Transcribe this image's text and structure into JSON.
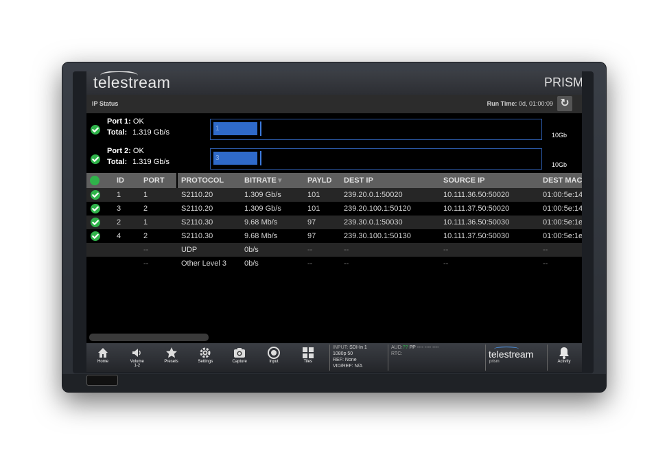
{
  "brand": {
    "logo": "telestream",
    "product": "PRISM"
  },
  "status": {
    "title": "IP Status",
    "runtime_label": "Run Time:",
    "runtime_value": "0d, 01:00:09",
    "reset_icon": "refresh-icon"
  },
  "ports": [
    {
      "label": "Port 1:",
      "status": "OK",
      "total_label": "Total:",
      "total": "1.319 Gb/s",
      "bar_label": "1",
      "bar_fraction": 0.135,
      "scale": "10Gb"
    },
    {
      "label": "Port 2:",
      "status": "OK",
      "total_label": "Total:",
      "total": "1.319 Gb/s",
      "bar_label": "3",
      "bar_fraction": 0.135,
      "scale": "10Gb"
    }
  ],
  "table": {
    "headers": {
      "id": "ID",
      "port": "PORT",
      "protocol": "PROTOCOL",
      "bitrate": "BITRATE",
      "payld": "PAYLD",
      "dest_ip": "DEST IP",
      "source_ip": "SOURCE IP",
      "dest_mac": "DEST MAC"
    },
    "rows": [
      {
        "ok": true,
        "id": "1",
        "port": "1",
        "protocol": "S2110.20",
        "bitrate": "1.309 Gb/s",
        "payld": "101",
        "dest_ip": "239.20.0.1:50020",
        "source_ip": "10.111.36.50:50020",
        "dest_mac": "01:00:5e:14"
      },
      {
        "ok": true,
        "id": "3",
        "port": "2",
        "protocol": "S2110.20",
        "bitrate": "1.309 Gb/s",
        "payld": "101",
        "dest_ip": "239.20.100.1:50120",
        "source_ip": "10.111.37.50:50020",
        "dest_mac": "01:00:5e:14"
      },
      {
        "ok": true,
        "id": "2",
        "port": "1",
        "protocol": "S2110.30",
        "bitrate": "9.68 Mb/s",
        "payld": "97",
        "dest_ip": "239.30.0.1:50030",
        "source_ip": "10.111.36.50:50030",
        "dest_mac": "01:00:5e:1e"
      },
      {
        "ok": true,
        "id": "4",
        "port": "2",
        "protocol": "S2110.30",
        "bitrate": "9.68 Mb/s",
        "payld": "97",
        "dest_ip": "239.30.100.1:50130",
        "source_ip": "10.111.37.50:50030",
        "dest_mac": "01:00:5e:1e"
      },
      {
        "ok": false,
        "id": "",
        "port": "--",
        "protocol": "UDP",
        "bitrate": "0b/s",
        "payld": "--",
        "dest_ip": "--",
        "source_ip": "--",
        "dest_mac": "--"
      },
      {
        "ok": false,
        "id": "",
        "port": "--",
        "protocol": "Other Level 3",
        "bitrate": "0b/s",
        "payld": "--",
        "dest_ip": "--",
        "source_ip": "--",
        "dest_mac": "--"
      }
    ]
  },
  "nav": [
    {
      "label": "Home",
      "sub": "",
      "icon": "home-icon"
    },
    {
      "label": "Volume",
      "sub": "1-2",
      "icon": "speaker-icon"
    },
    {
      "label": "Presets",
      "sub": "",
      "icon": "star-icon"
    },
    {
      "label": "Settings",
      "sub": "",
      "icon": "gear-icon"
    },
    {
      "label": "Capture",
      "sub": "",
      "icon": "camera-icon"
    },
    {
      "label": "Input",
      "sub": "",
      "icon": "input-icon"
    },
    {
      "label": "Tiles",
      "sub": "",
      "icon": "tiles-icon"
    }
  ],
  "info": {
    "input_label": "INPUT:",
    "input_value": "SDI-In 1",
    "format": "1080p 50",
    "ref": "REF: None",
    "vidref": "VID/REF: N/A",
    "aud_label": "AUD:",
    "aud_value": "PP ---- ---- ----",
    "aud_marker": "??",
    "rtc": "RTC:"
  },
  "footer_brand": {
    "logo": "telestream",
    "product": "prism"
  },
  "activity": {
    "label": "Activity",
    "icon": "bell-icon"
  },
  "colors": {
    "ok": "#2fb34a",
    "bar": "#2f6ac9",
    "bar_border": "#2c5aa8"
  }
}
